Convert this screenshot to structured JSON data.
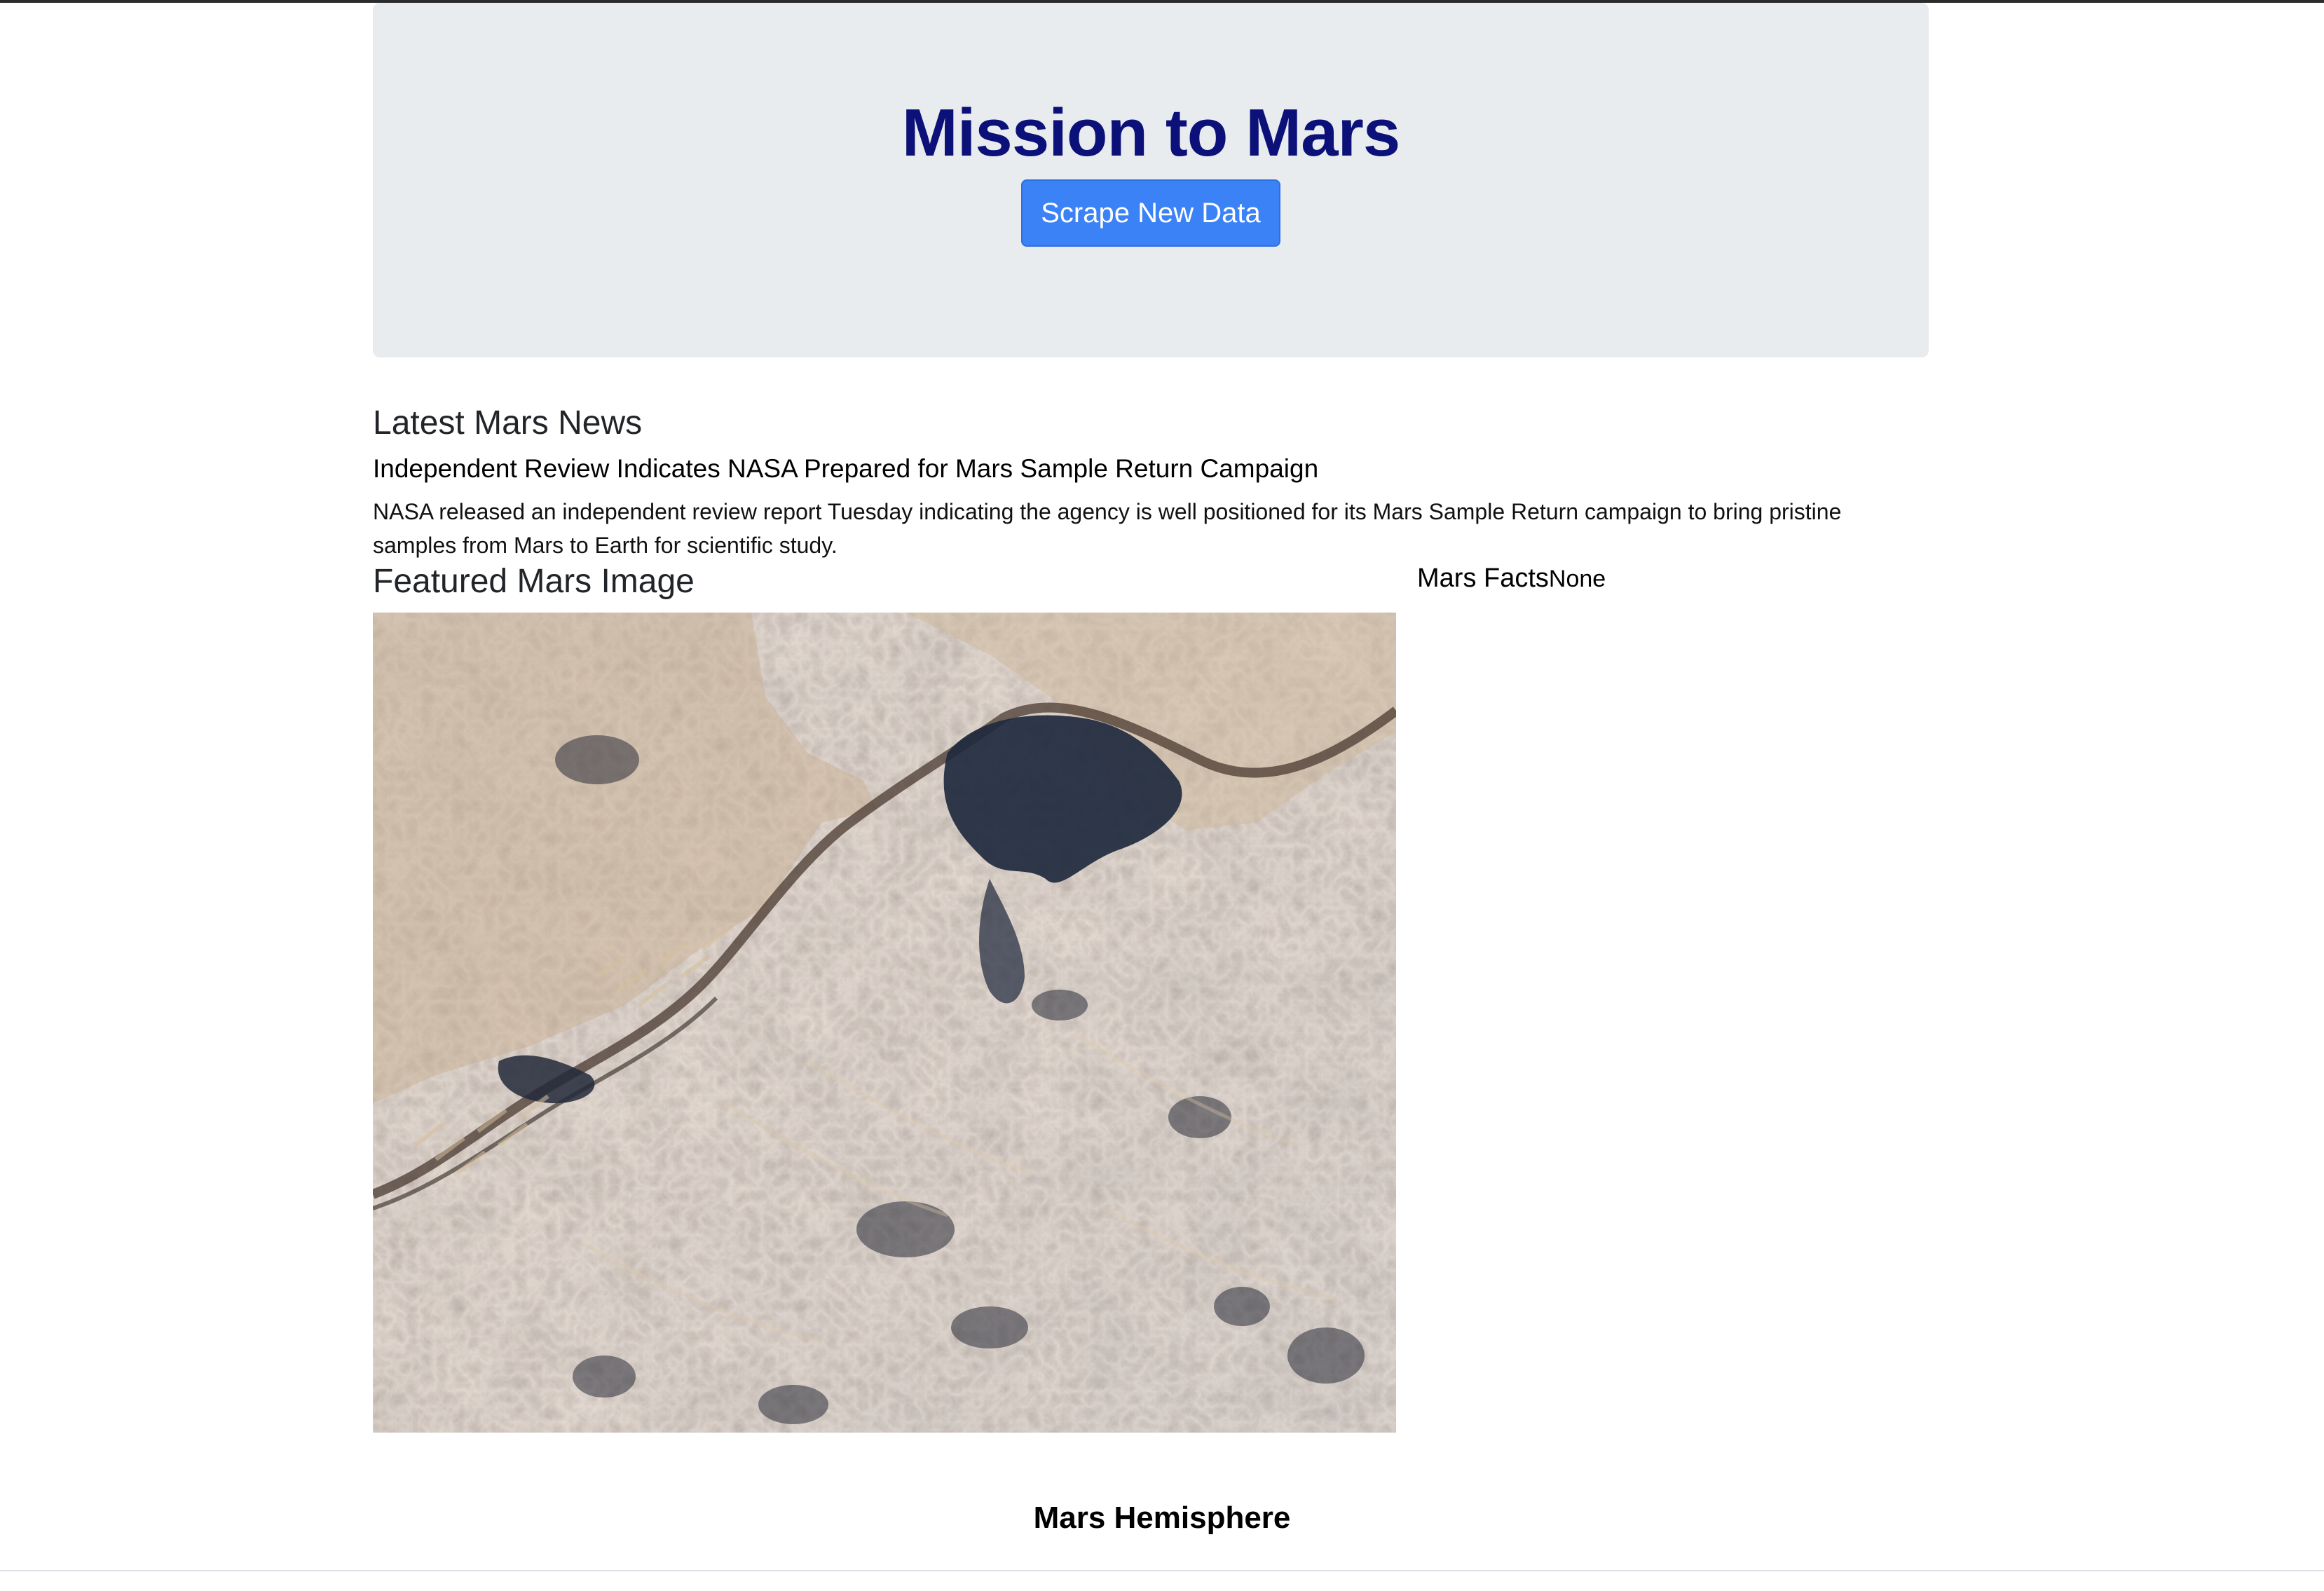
{
  "header": {
    "title": "Mission to Mars",
    "scrape_button_label": "Scrape New Data"
  },
  "news": {
    "section_heading": "Latest Mars News",
    "title": "Independent Review Indicates NASA Prepared for Mars Sample Return Campaign",
    "paragraph": "NASA released an independent review report Tuesday indicating the agency is well positioned for its Mars Sample Return campaign to bring pristine samples from Mars to Earth for scientific study."
  },
  "featured_image": {
    "section_heading": "Featured Mars Image"
  },
  "facts": {
    "label": "Mars Facts",
    "value": "None"
  },
  "hemispheres": {
    "section_heading": "Mars Hemisphere"
  },
  "colors": {
    "title": "#0b1178",
    "button": "#3b82f6",
    "jumbotron": "#e9ecef"
  }
}
